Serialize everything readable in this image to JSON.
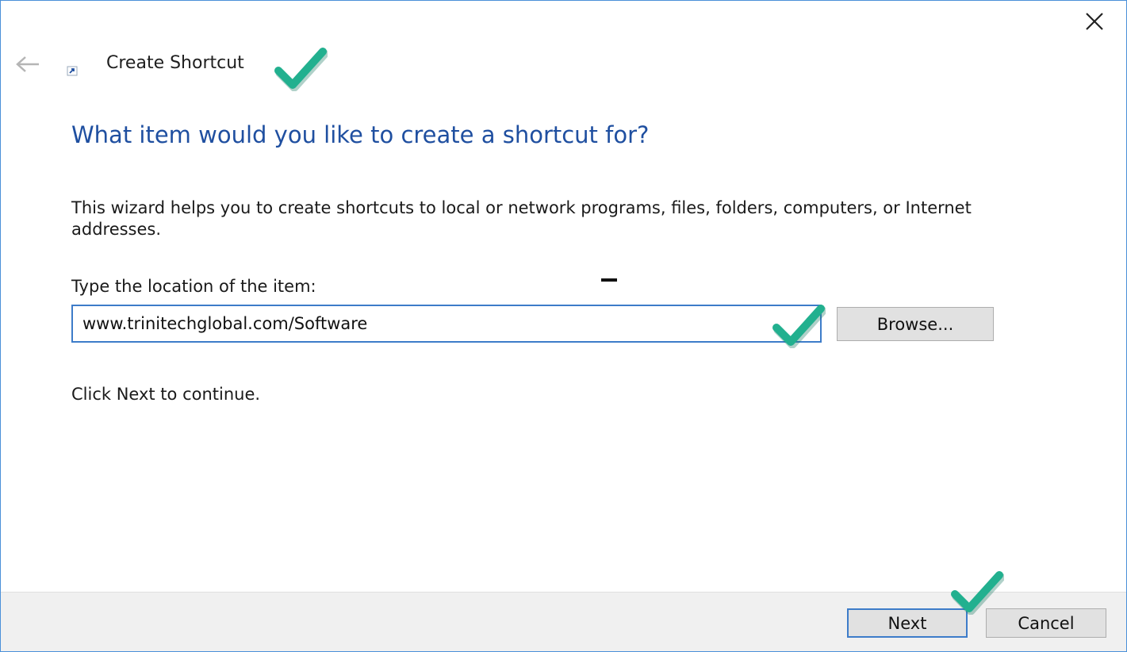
{
  "window": {
    "title": "Create Shortcut"
  },
  "content": {
    "heading": "What item would you like to create a shortcut for?",
    "description": "This wizard helps you to create shortcuts to local or network programs, files, folders, computers, or Internet addresses.",
    "location_label": "Type the location of the item:",
    "location_value": "www.trinitechglobal.com/Software",
    "browse_label": "Browse...",
    "continue_text": "Click Next to continue."
  },
  "footer": {
    "next_label": "Next",
    "cancel_label": "Cancel"
  },
  "colors": {
    "heading": "#1f4fa0",
    "focus_border": "#3d7cc9",
    "annotation_check": "#22b08f"
  },
  "icons": {
    "close": "close-icon",
    "back": "back-arrow-icon",
    "wizard": "shortcut-icon",
    "annotation": "checkmark-icon"
  }
}
